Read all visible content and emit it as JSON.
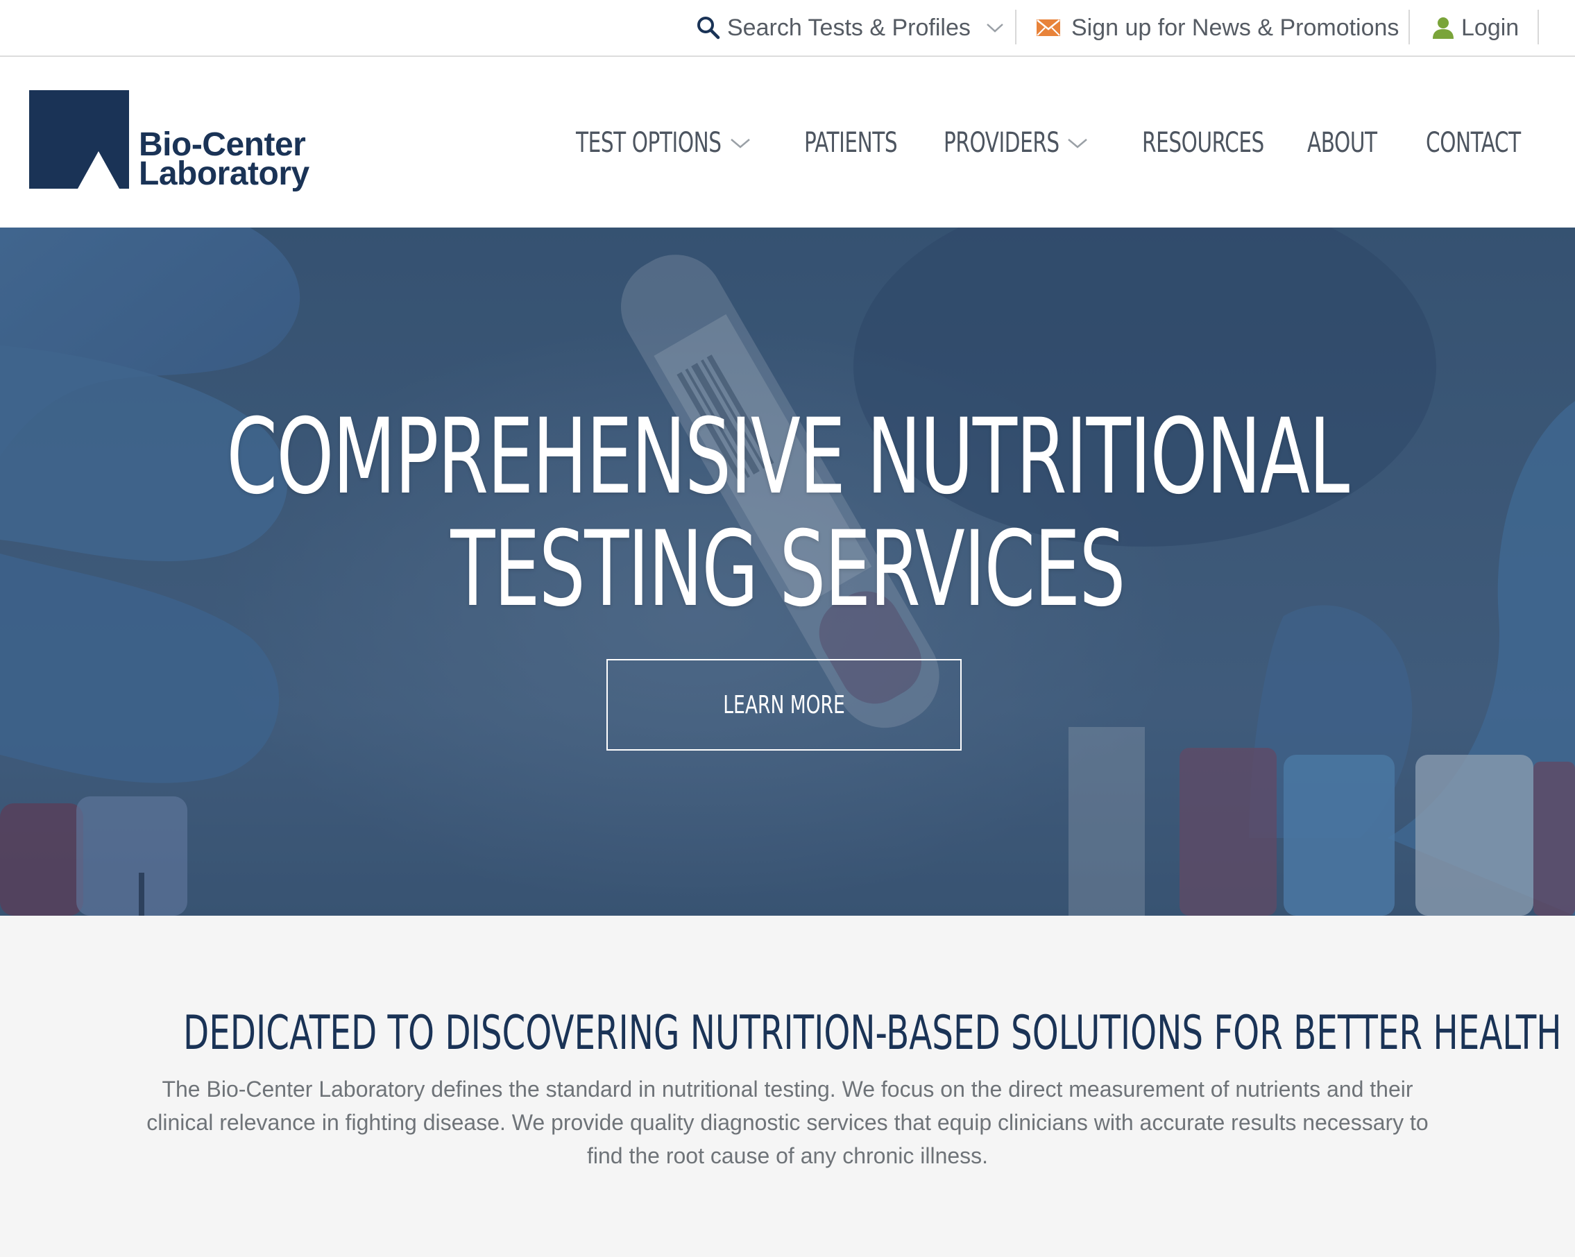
{
  "utility_bar": {
    "search_label": "Search Tests & Profiles",
    "news_label": "Sign up for News & Promotions",
    "login_label": "Login",
    "icons": {
      "search": "search-icon",
      "news": "envelope-icon",
      "login": "user-icon"
    },
    "icon_colors": {
      "search": "#1a3356",
      "news": "#e8833a",
      "login": "#7aa43a"
    }
  },
  "logo": {
    "line1": "Bio-Center",
    "line2": "Laboratory",
    "color": "#1a3356"
  },
  "nav": {
    "items": [
      {
        "label": "TEST OPTIONS",
        "has_dropdown": true
      },
      {
        "label": "PATIENTS",
        "has_dropdown": false
      },
      {
        "label": "PROVIDERS",
        "has_dropdown": true
      },
      {
        "label": "RESOURCES",
        "has_dropdown": false
      },
      {
        "label": "ABOUT",
        "has_dropdown": false
      },
      {
        "label": "CONTACT",
        "has_dropdown": false
      }
    ]
  },
  "hero": {
    "title_line1": "COMPREHENSIVE NUTRITIONAL",
    "title_line2": "TESTING SERVICES",
    "button_label": "LEARN MORE",
    "overlay_color": "#3f5b7c"
  },
  "intro": {
    "heading": "DEDICATED TO DISCOVERING NUTRITION-BASED SOLUTIONS FOR BETTER HEALTH",
    "body": "The Bio-Center Laboratory defines the standard in nutritional testing. We focus on the direct measurement of nutrients and their clinical relevance in fighting disease. We provide quality diagnostic services that equip clinicians with accurate results necessary to find the root cause of any chronic illness."
  }
}
